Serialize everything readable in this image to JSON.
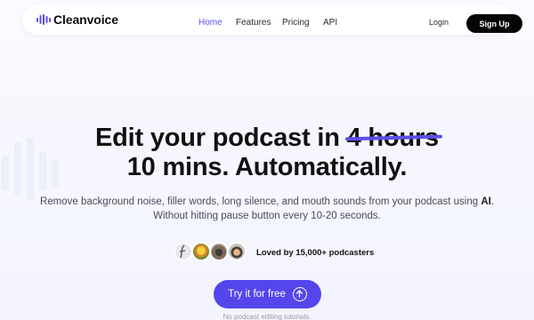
{
  "brand": {
    "name": "Cleanvoice",
    "icon": "waveform-logo-icon",
    "accent": "#5b4fe8"
  },
  "nav": {
    "links": [
      {
        "label": "Home",
        "active": true
      },
      {
        "label": "Features",
        "active": false
      },
      {
        "label": "Pricing",
        "active": false
      },
      {
        "label": "API",
        "active": false
      }
    ],
    "login": "Login",
    "signup": "Sign Up"
  },
  "hero": {
    "headline_part1": "Edit your podcast in",
    "headline_struck": "4 hours",
    "headline_line2": "10 mins. Automatically.",
    "subtitle_line1_a": "Remove background noise, filler words, long silence, and mouth sounds from your podcast using ",
    "subtitle_line1_bold": "AI",
    "subtitle_line1_end": ".",
    "subtitle_line2": "Without hitting pause button every 10-20 seconds."
  },
  "social_proof": {
    "text": "Loved by 15,000+ podcasters",
    "avatar_count": 4
  },
  "cta": {
    "label": "Try it for free",
    "icon": "arrow-up-circle-icon",
    "color": "#5546ec"
  },
  "footnote": "No podcast editing tutorials."
}
